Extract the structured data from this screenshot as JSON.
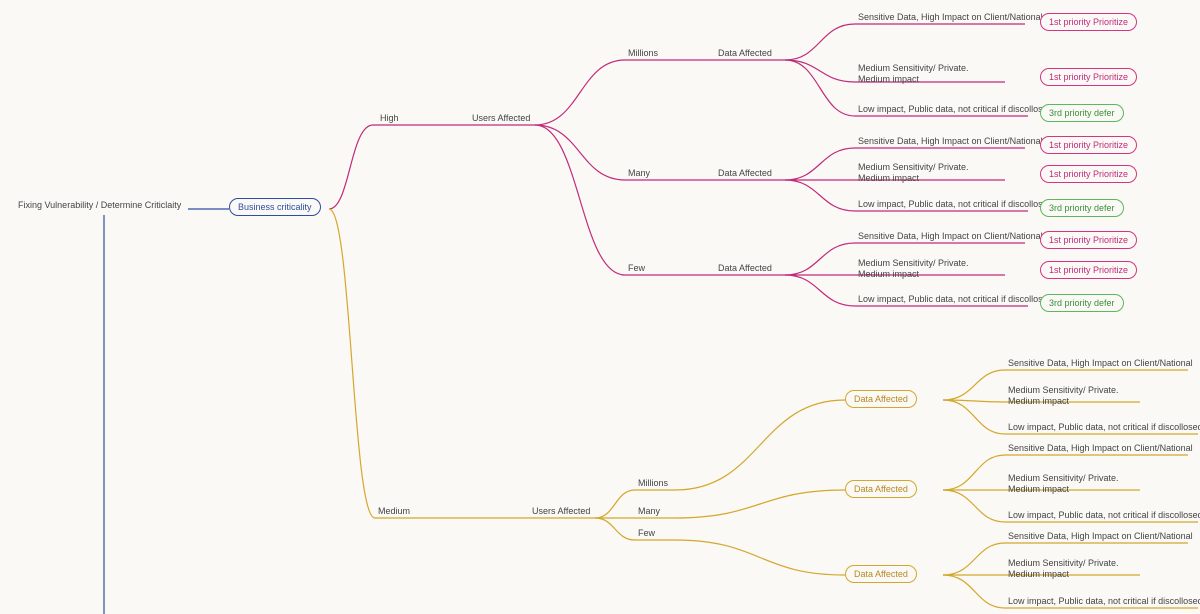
{
  "root": {
    "label": "Fixing Vulnerability / Determine Criticlaity"
  },
  "business_criticality": {
    "label": "Business criticality"
  },
  "high": {
    "label": "High",
    "users_affected": "Users Affected",
    "groups": {
      "millions": {
        "label": "Millions",
        "data_affected": "Data Affected",
        "rows": {
          "sensitive": {
            "text": "Sensitive Data, High Impact on Client/National",
            "pill": "1st priority Prioritize",
            "pill_color": "pink"
          },
          "medium": {
            "text": "Medium Sensitivity/ Private.\nMedium impact",
            "pill": "1st priority Prioritize",
            "pill_color": "pink"
          },
          "low": {
            "text": "Low impact, Public data, not critical if discollosed",
            "pill": "3rd priority defer",
            "pill_color": "green"
          }
        }
      },
      "many": {
        "label": "Many",
        "data_affected": "Data Affected",
        "rows": {
          "sensitive": {
            "text": "Sensitive Data, High Impact on Client/National",
            "pill": "1st priority Prioritize",
            "pill_color": "pink"
          },
          "medium": {
            "text": "Medium Sensitivity/ Private.\nMedium impact",
            "pill": "1st priority Prioritize",
            "pill_color": "pink"
          },
          "low": {
            "text": "Low impact, Public data, not critical if discollosed",
            "pill": "3rd priority defer",
            "pill_color": "green"
          }
        }
      },
      "few": {
        "label": "Few",
        "data_affected": "Data Affected",
        "rows": {
          "sensitive": {
            "text": "Sensitive Data, High Impact on Client/National",
            "pill": "1st priority Prioritize",
            "pill_color": "pink"
          },
          "medium": {
            "text": "Medium Sensitivity/ Private.\nMedium impact",
            "pill": "1st priority Prioritize",
            "pill_color": "pink"
          },
          "low": {
            "text": "Low impact, Public data, not critical if discollosed",
            "pill": "3rd priority defer",
            "pill_color": "green"
          }
        }
      }
    }
  },
  "medium": {
    "label": "Medium",
    "users_affected": "Users Affected",
    "groups": {
      "millions": {
        "label": "Millions",
        "data_affected": "Data Affected",
        "rows": {
          "sensitive": {
            "text": "Sensitive Data, High Impact on Client/National"
          },
          "medium": {
            "text": "Medium Sensitivity/ Private.\nMedium impact"
          },
          "low": {
            "text": "Low impact, Public data, not critical if discollosed"
          }
        }
      },
      "many": {
        "label": "Many",
        "data_affected": "Data Affected",
        "rows": {
          "sensitive": {
            "text": "Sensitive Data, High Impact on Client/National"
          },
          "medium": {
            "text": "Medium Sensitivity/ Private.\nMedium impact"
          },
          "low": {
            "text": "Low impact, Public data, not critical if discollosed"
          }
        }
      },
      "few": {
        "label": "Few",
        "data_affected": "Data Affected",
        "rows": {
          "sensitive": {
            "text": "Sensitive Data, High Impact on Client/National"
          },
          "medium": {
            "text": "Medium Sensitivity/ Private.\nMedium impact"
          },
          "low": {
            "text": "Low impact, Public data, not critical if discollosed"
          }
        }
      }
    }
  },
  "colors": {
    "pink": "#c12a7b",
    "yellow": "#d4a72c",
    "blue": "#2b4fa2",
    "green": "#5cb85c"
  }
}
